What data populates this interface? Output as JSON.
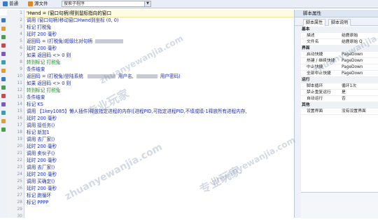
{
  "toolbar": {
    "tab_normal": "普通",
    "tab_source": "源文件",
    "search_placeholder": "搜索子程序"
  },
  "editor": {
    "line_numbers": [
      "1",
      "2",
      "3",
      "4",
      "5",
      "6",
      "7",
      "8",
      "9",
      "10",
      "11",
      "12",
      "13",
      "14",
      "15",
      "16",
      "17",
      "18",
      "19",
      "20",
      "21",
      "22",
      "23",
      "24",
      "25",
      "26",
      "27",
      "28",
      "29",
      "30"
    ],
    "lines": [
      {
        "text": "'Hwnd = (窗口句柄)得到鼠标指向的窗口",
        "cls": "hl"
      },
      {
        "text": "调用 (窗口句柄)移动窗口Hwnd到坐标 (0, 0)",
        "cls": ""
      },
      {
        "text": "标记 打税兔",
        "cls": ""
      },
      {
        "text": "延时 200 毫秒",
        "cls": ""
      },
      {
        "text": "返回码 = (打税兔)超级比对句柄",
        "cls": ""
      },
      {
        "text": "延时 200 毫秒",
        "cls": ""
      },
      {
        "text": "如果 返回码 <> 0 则",
        "cls": ""
      },
      {
        "text": "    转到标记 打税兔",
        "cls": "cmt"
      },
      {
        "text": "条件结束",
        "cls": ""
      },
      {
        "text": "返回码 = (打税兔)登陆系统 ",
        "cls": "",
        "extra1": "用户名,",
        "extra2": "用户密码)"
      },
      {
        "text": "如果 返回码 <> 0 则",
        "cls": ""
      },
      {
        "text": "    转到标记 打税兔",
        "cls": "cmt"
      },
      {
        "text": "条件结束",
        "cls": ""
      },
      {
        "text": "标记 KS",
        "cls": ""
      },
      {
        "text": "调用 【1key1085】懒人插件)释放指定进程的内存([进程PID,可指定进程PID,不填或填-1释放所有进程内存,",
        "cls": ""
      },
      {
        "text": "延时 200 毫秒",
        "cls": ""
      },
      {
        "text": "调用 接任务()",
        "cls": ""
      },
      {
        "text": "标记 新加1",
        "cls": ""
      },
      {
        "text": "调用 去厂家()",
        "cls": ""
      },
      {
        "text": "延时 200 毫秒",
        "cls": ""
      },
      {
        "text": "调用 卖伙子()",
        "cls": ""
      },
      {
        "text": "延时 200 毫秒",
        "cls": ""
      },
      {
        "text": "调用 去厂家()",
        "cls": ""
      },
      {
        "text": "延时 200 毫秒",
        "cls": ""
      },
      {
        "text": "调用 买确定()",
        "cls": ""
      },
      {
        "text": "延时 200 毫秒",
        "cls": ""
      },
      {
        "text": "标记 跑循环",
        "cls": ""
      },
      {
        "text": "标记 PPPP",
        "cls": ""
      }
    ]
  },
  "right_panel": {
    "title": "脚本属性",
    "tab_props": "脚本属性",
    "tab_desc": "脚本说明",
    "rows": [
      {
        "k": "基本",
        "v": "",
        "cat": true
      },
      {
        "k": "描述",
        "v": "结鹿原始",
        "cat": false
      },
      {
        "k": "文件名",
        "v": "结鹿原始 Q",
        "cat": false
      },
      {
        "k": "界面",
        "v": "",
        "cat": true
      },
      {
        "k": "启动快捷",
        "v": "PageDown",
        "cat": false
      },
      {
        "k": "热键 / 继续快捷",
        "v": "PageDown",
        "cat": false
      },
      {
        "k": "中止快捷",
        "v": "PageDown",
        "cat": false
      },
      {
        "k": "全部中止快捷",
        "v": "PageDown",
        "cat": false
      },
      {
        "k": "运行",
        "v": "",
        "cat": true
      },
      {
        "k": "脚本循环",
        "v": "循环1次",
        "cat": false
      },
      {
        "k": "禁止重复运行",
        "v": "是",
        "cat": false
      },
      {
        "k": "自动运行",
        "v": "否",
        "cat": false
      },
      {
        "k": "其他",
        "v": "",
        "cat": true
      },
      {
        "k": "设置界面",
        "v": "没有设置界面",
        "cat": false
      }
    ]
  },
  "watermarks": [
    "专业玩家",
    "zhuanyewanjia.com",
    "专业玩家",
    "zhuanyewanjia.com",
    "玩家"
  ]
}
